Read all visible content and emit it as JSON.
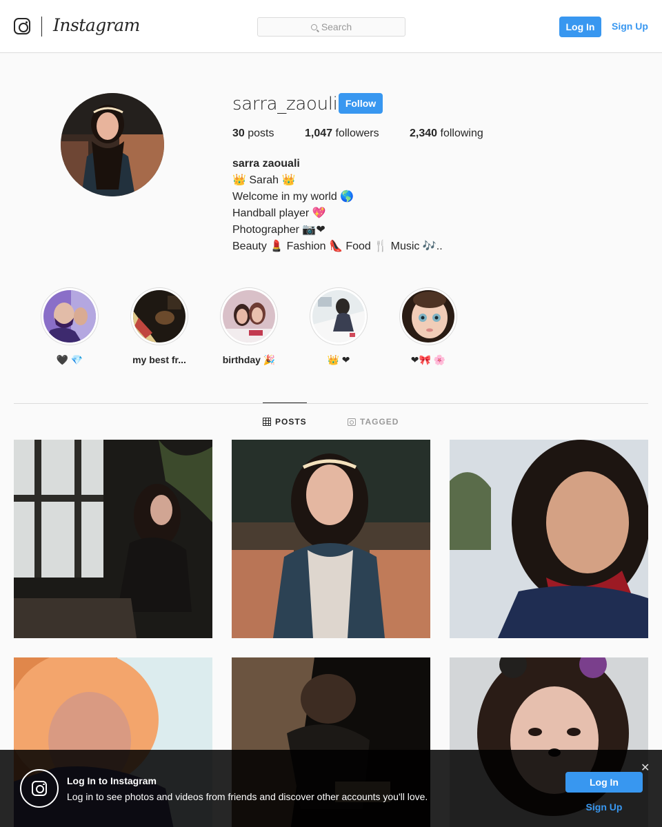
{
  "header": {
    "wordmark": "Instagram",
    "search_placeholder": "Search",
    "login_label": "Log In",
    "signup_label": "Sign Up"
  },
  "profile": {
    "username": "sarra_zaouli",
    "follow_label": "Follow",
    "stats": {
      "posts_count": "30",
      "posts_label": "posts",
      "followers_count": "1,047",
      "followers_label": "followers",
      "following_count": "2,340",
      "following_label": "following"
    },
    "bio": {
      "full_name": "sarra zaouali",
      "lines": [
        "👑 Sarah 👑",
        "Welcome in my world 🌎",
        "Handball player 💖",
        "Photographer 📷❤",
        "Beauty 💄 Fashion 👠 Food 🍴 Music 🎶.."
      ]
    }
  },
  "highlights": [
    {
      "label": "🖤 💎"
    },
    {
      "label": "my best fr..."
    },
    {
      "label": "birthday 🎉"
    },
    {
      "label": "👑 ❤"
    },
    {
      "label": "❤🎀 🌸"
    }
  ],
  "tabs": [
    {
      "label": "POSTS",
      "icon": "grid-icon",
      "active": true
    },
    {
      "label": "TAGGED",
      "icon": "tagged-icon",
      "active": false
    }
  ],
  "bottom_bar": {
    "title": "Log In to Instagram",
    "text": "Log in to see photos and videos from friends and discover other accounts you'll love.",
    "login_label": "Log In",
    "signup_label": "Sign Up",
    "close_glyph": "✕"
  },
  "colors": {
    "accent": "#3897f0",
    "text": "#262626",
    "muted": "#999999",
    "border": "#dbdbdb",
    "background": "#fafafa"
  }
}
